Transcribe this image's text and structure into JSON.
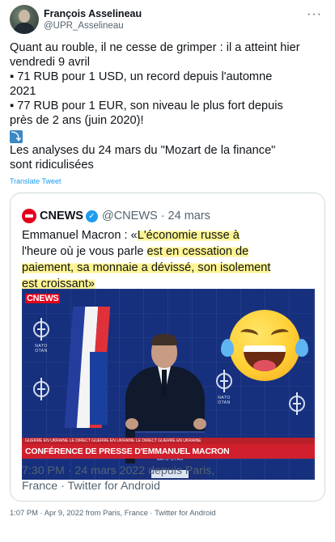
{
  "author": {
    "name": "François Asselineau",
    "handle": "@UPR_Asselineau"
  },
  "header": {
    "more_label": "···"
  },
  "tweet": {
    "lines": [
      "Quant au rouble, il ne cesse de grimper : il a atteint hier",
      "vendredi 9 avril",
      " ▪ 71 RUB pour 1 USD, un record depuis l'automne",
      "2021",
      " ▪ 77 RUB pour 1 EUR, son niveau le plus fort depuis",
      "près de 2 ans (juin 2020)!",
      "Les analyses du 24 mars du \"Mozart de la finance\"",
      "sont ridiculisées"
    ],
    "arrow_icon": "⤵",
    "translate_label": "Translate Tweet"
  },
  "quote": {
    "author_name": "CNEWS",
    "verified_icon": "✓",
    "handle": "@CNEWS",
    "separator": "·",
    "date": "24 mars",
    "lines": [
      {
        "plain": "Emmanuel Macron : «",
        "highlight": "L'économie russe à"
      },
      {
        "plain": "l'heure où je vous parle ",
        "highlight": "est en cessation de"
      },
      {
        "plain": "",
        "highlight": "paiement, sa monnaie a dévissé, son isolement"
      },
      {
        "plain": "",
        "highlight": "est croissant»"
      }
    ],
    "media": {
      "channel_logo": "CNEWS",
      "nato_label": "NATO OTAN",
      "ticker": "GUERRE EN UKRAINE   LE DIRECT   GUERRE EN UKRAINE   LE DIRECT   GUERRE EN UKRAINE",
      "banner": "CONFÉRENCE DE PRESSE D'EMMANUEL MACRON",
      "emoji": "face-with-tears-of-joy",
      "colors": {
        "background": "#16307e",
        "banner": "#d0202d",
        "cnews_red": "#e3001b"
      }
    },
    "footer_lines": [
      "7:30 PM · 24 mars 2022 depuis Paris,",
      "France · Twitter for Android"
    ]
  },
  "meta": "1:07 PM · Apr 9, 2022 from Paris, France · Twitter for Android"
}
